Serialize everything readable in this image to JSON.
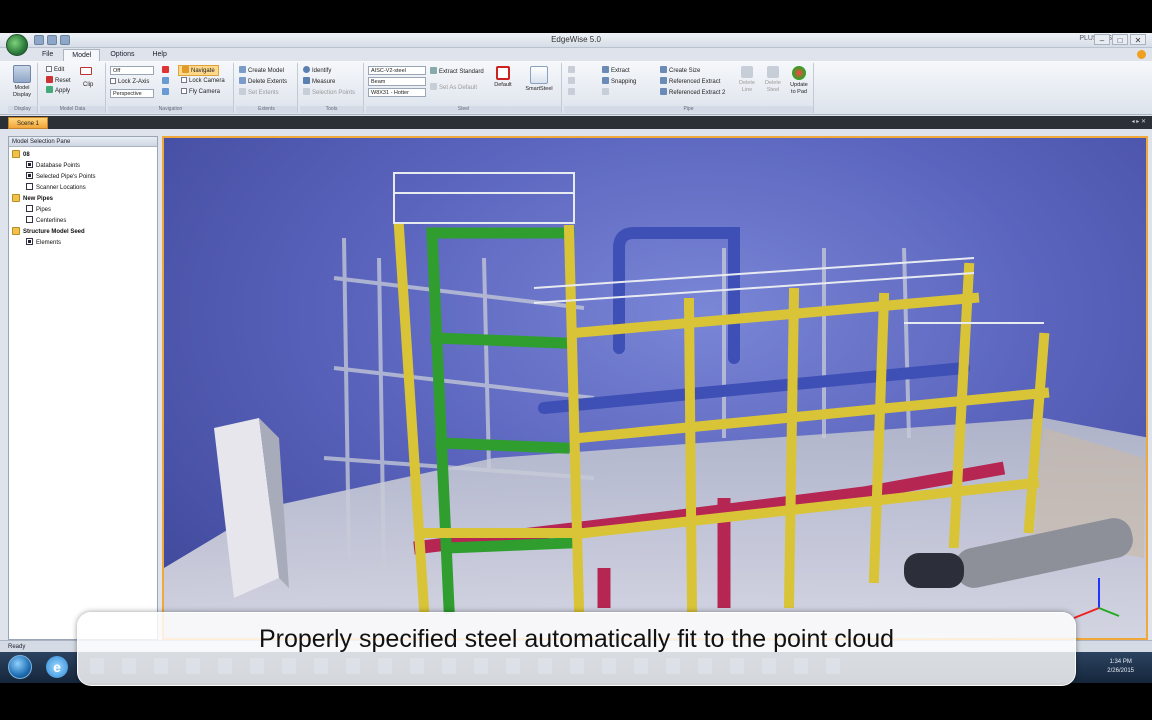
{
  "app": {
    "title": "EdgeWise 5.0",
    "ribbon_right_label": "PLUSERS"
  },
  "menu_tabs": [
    "File",
    "Model",
    "Options",
    "Help"
  ],
  "ribbon": {
    "model_display": "Model Display",
    "edit": "Edit",
    "reset": "Reset",
    "apply": "Apply",
    "clip": "Clip",
    "view_mode": "Off",
    "lock_z_axis": "Lock Z-Axis",
    "projection": "Perspective",
    "navigate": "Navigate",
    "lock_camera": "Lock Camera",
    "fly_camera": "Fly Camera",
    "create_model": "Create Model",
    "delete_extents": "Delete Extents",
    "set_extents": "Set Extents",
    "identify": "Identify",
    "measure": "Measure",
    "selection_points": "Selection Points",
    "steel_spec": "AISC-V2-steel",
    "steel_type": "Beam",
    "steel_size": "W8X31 - Hotter",
    "extract_standard": "Extract Standard",
    "set_as_default": "Set As Default",
    "default_label": "Default",
    "smartsteel": "SmartSteel",
    "extract": "Extract",
    "snapping": "Snapping",
    "create_size": "Create Size",
    "referenced_extract": "Referenced Extract",
    "referenced_extract_2": "Referenced Extract 2",
    "delete_line": "Delete Line",
    "delete_steel": "Delete Steel",
    "update_to_pipe": "Update to Pad",
    "groups": [
      "Display",
      "Model Data",
      "Navigation",
      "Extents",
      "Tools",
      "Steel",
      "Pipe"
    ]
  },
  "document_tab": "Scene 1",
  "left_panel": {
    "title": "Model Selection Pane",
    "tree": [
      {
        "label": "08",
        "type": "folder",
        "level": 0
      },
      {
        "label": "Database Points",
        "type": "check",
        "checked": true,
        "level": 1
      },
      {
        "label": "Selected Pipe's Points",
        "type": "check",
        "checked": true,
        "level": 1
      },
      {
        "label": "Scanner Locations",
        "type": "check",
        "checked": false,
        "level": 1
      },
      {
        "label": "New Pipes",
        "type": "folder",
        "level": 0
      },
      {
        "label": "Pipes",
        "type": "check",
        "checked": false,
        "level": 1
      },
      {
        "label": "Centerlines",
        "type": "check",
        "checked": false,
        "level": 1
      },
      {
        "label": "Structure Model Seed",
        "type": "folder",
        "level": 0
      },
      {
        "label": "Elements",
        "type": "check",
        "checked": true,
        "level": 1
      }
    ]
  },
  "status": "Ready",
  "taskbar": {
    "ie_label": "e",
    "time": "1:34 PM",
    "date": "2/26/2015"
  },
  "caption": "Properly specified steel automatically fit to the point cloud",
  "colors": {
    "selected_tab": "#f2a63a",
    "steel_yellow": "#d9c437",
    "steel_green": "#2f9e2f",
    "background_blue": "#5a64bd"
  }
}
